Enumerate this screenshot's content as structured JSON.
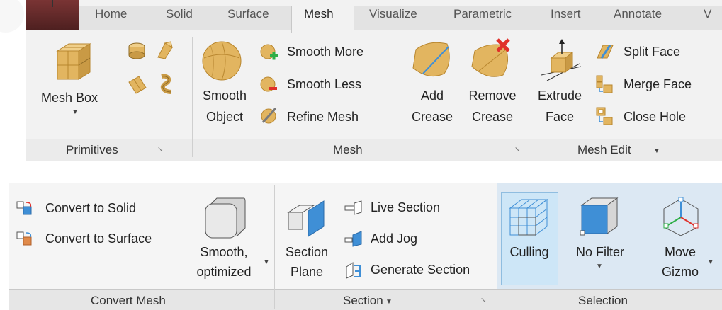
{
  "tabs": [
    {
      "label": "Home"
    },
    {
      "label": "Solid"
    },
    {
      "label": "Surface"
    },
    {
      "label": "Mesh",
      "active": true
    },
    {
      "label": "Visualize"
    },
    {
      "label": "Parametric"
    },
    {
      "label": "Insert"
    },
    {
      "label": "Annotate"
    },
    {
      "label": "V"
    }
  ],
  "primitives": {
    "mesh_box": "Mesh Box",
    "title": "Primitives"
  },
  "mesh": {
    "smooth_object_1": "Smooth",
    "smooth_object_2": "Object",
    "smooth_more": "Smooth More",
    "smooth_less": "Smooth Less",
    "refine_mesh": "Refine Mesh",
    "add_crease_1": "Add",
    "add_crease_2": "Crease",
    "remove_crease_1": "Remove",
    "remove_crease_2": "Crease",
    "title": "Mesh"
  },
  "mesh_edit": {
    "extrude_face_1": "Extrude",
    "extrude_face_2": "Face",
    "split_face": "Split Face",
    "merge_face": "Merge Face",
    "close_hole": "Close Hole",
    "title": "Mesh Edit"
  },
  "convert_mesh": {
    "to_solid": "Convert to Solid",
    "to_surface": "Convert to Surface",
    "smooth_opt_1": "Smooth,",
    "smooth_opt_2": "optimized",
    "title": "Convert Mesh"
  },
  "section": {
    "section_plane_1": "Section",
    "section_plane_2": "Plane",
    "live_section": "Live Section",
    "add_jog": "Add Jog",
    "generate_section": "Generate Section",
    "title": "Section"
  },
  "selection": {
    "culling": "Culling",
    "no_filter": "No Filter",
    "move_gizmo_1": "Move",
    "move_gizmo_2": "Gizmo",
    "title": "Selection"
  },
  "colors": {
    "gold": "#e2b560",
    "gold_dark": "#b8862e",
    "blue": "#3f8fd6",
    "red": "#e0302a",
    "highlight": "#cde6f7"
  }
}
